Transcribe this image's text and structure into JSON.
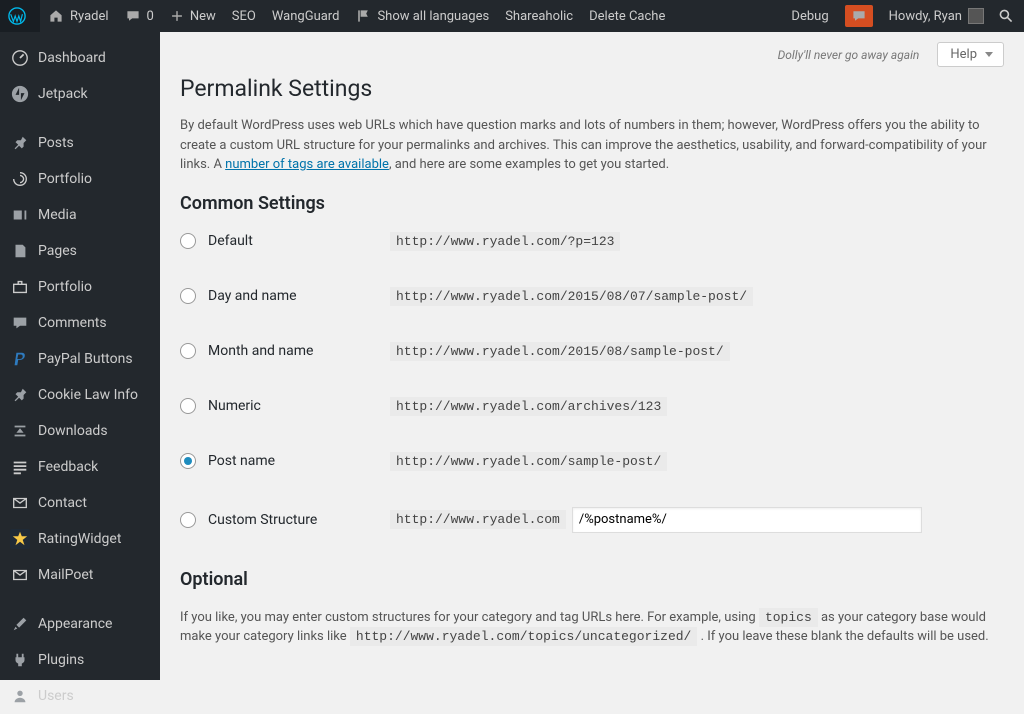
{
  "adminbar": {
    "site_name": "Ryadel",
    "comments_count": "0",
    "new_label": "New",
    "items": [
      "SEO",
      "WangGuard",
      "Show all languages",
      "Shareaholic",
      "Delete Cache"
    ],
    "debug": "Debug",
    "howdy": "Howdy, Ryan"
  },
  "sidebar": [
    {
      "label": "Dashboard",
      "icon": "dashboard"
    },
    {
      "label": "Jetpack",
      "icon": "jetpack"
    },
    {
      "sep": true
    },
    {
      "label": "Posts",
      "icon": "pin"
    },
    {
      "label": "Portfolio",
      "icon": "swirl"
    },
    {
      "label": "Media",
      "icon": "media"
    },
    {
      "label": "Pages",
      "icon": "pages"
    },
    {
      "label": "Portfolio",
      "icon": "briefcase"
    },
    {
      "label": "Comments",
      "icon": "comments"
    },
    {
      "label": "PayPal Buttons",
      "icon": "paypal",
      "klass": "paypal"
    },
    {
      "label": "Cookie Law Info",
      "icon": "pin"
    },
    {
      "label": "Downloads",
      "icon": "download"
    },
    {
      "label": "Feedback",
      "icon": "feedback"
    },
    {
      "label": "Contact",
      "icon": "envelope"
    },
    {
      "label": "RatingWidget",
      "icon": "star",
      "klass": "rating"
    },
    {
      "label": "MailPoet",
      "icon": "envelope"
    },
    {
      "sep": true
    },
    {
      "label": "Appearance",
      "icon": "brush"
    },
    {
      "label": "Plugins",
      "icon": "plug"
    },
    {
      "label": "Users",
      "icon": "users"
    }
  ],
  "page": {
    "dolly": "Dolly'll never go away again",
    "help": "Help",
    "title": "Permalink Settings",
    "intro_a": "By default WordPress uses web URLs which have question marks and lots of numbers in them; however, WordPress offers you the ability to create a custom URL structure for your permalinks and archives. This can improve the aesthetics, usability, and forward-compatibility of your links. A ",
    "intro_link": "number of tags are available",
    "intro_b": ", and here are some examples to get you started.",
    "common_heading": "Common Settings",
    "options": [
      {
        "label": "Default",
        "example": "http://www.ryadel.com/?p=123",
        "checked": false
      },
      {
        "label": "Day and name",
        "example": "http://www.ryadel.com/2015/08/07/sample-post/",
        "checked": false
      },
      {
        "label": "Month and name",
        "example": "http://www.ryadel.com/2015/08/sample-post/",
        "checked": false
      },
      {
        "label": "Numeric",
        "example": "http://www.ryadel.com/archives/123",
        "checked": false
      },
      {
        "label": "Post name",
        "example": "http://www.ryadel.com/sample-post/",
        "checked": true
      }
    ],
    "custom_label": "Custom Structure",
    "custom_prefix": "http://www.ryadel.com",
    "custom_value": "/%postname%/",
    "optional_heading": "Optional",
    "opt_a": "If you like, you may enter custom structures for your category and tag URLs here. For example, using ",
    "opt_code1": "topics",
    "opt_b": " as your category base would make your category links like ",
    "opt_code2": "http://www.ryadel.com/topics/uncategorized/",
    "opt_c": " . If you leave these blank the defaults will be used."
  }
}
